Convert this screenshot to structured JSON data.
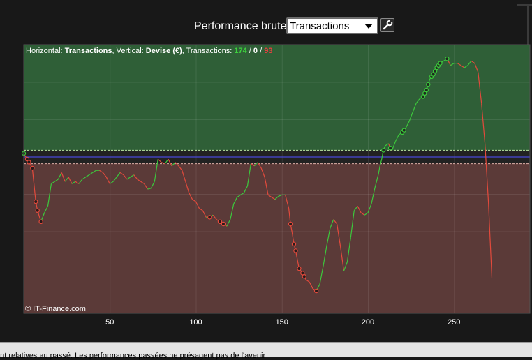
{
  "header": {
    "title": "Performance brute",
    "view_selected": "Transactions",
    "tool_icon": "wrench-icon"
  },
  "info": {
    "h_prefix": "Horizontal: ",
    "h_value": "Transactions",
    "v_prefix": ", Vertical: ",
    "v_value": "Devise (€)",
    "t_prefix": ", Transactions: ",
    "t_win": "174",
    "sep1": " / ",
    "t_flat": "0",
    "sep2": " / ",
    "t_loss": "93"
  },
  "watermark": "© IT-Finance.com",
  "footer": {
    "disclaimer": "ont relatives au passé. Les performances passées ne présagent pas de l'avenir"
  },
  "colors": {
    "profit_zone": "#2f5f37",
    "loss_zone": "#5b3a38",
    "gain_line": "#3cc83c",
    "loss_line": "#e24a3c",
    "baseline": "#4a4ad8",
    "win_count": "#3ed23e",
    "loss_count": "#e84040"
  },
  "chart_data": {
    "type": "line",
    "xlabel": "",
    "ylabel": "",
    "x_ticks": [
      50,
      100,
      150,
      200,
      250
    ],
    "xlim": [
      0,
      293
    ],
    "grid": true,
    "baseline": 0,
    "upper_band": 0.15,
    "lower_band": -0.15,
    "y_unit_note": "no y tick labels shown",
    "series": [
      {
        "points": [
          [
            0,
            0.08
          ],
          [
            2,
            -0.05
          ],
          [
            4,
            -0.18
          ],
          [
            5,
            -0.25
          ],
          [
            7,
            -1.0
          ],
          [
            8,
            -1.2
          ],
          [
            10,
            -1.45
          ],
          [
            12,
            -1.25
          ],
          [
            14,
            -1.1
          ],
          [
            16,
            -0.6
          ],
          [
            18,
            -0.55
          ],
          [
            20,
            -0.5
          ],
          [
            22,
            -0.35
          ],
          [
            24,
            -0.55
          ],
          [
            26,
            -0.45
          ],
          [
            28,
            -0.6
          ],
          [
            30,
            -0.55
          ],
          [
            32,
            -0.6
          ],
          [
            34,
            -0.5
          ],
          [
            36,
            -0.45
          ],
          [
            38,
            -0.4
          ],
          [
            40,
            -0.35
          ],
          [
            42,
            -0.3
          ],
          [
            44,
            -0.3
          ],
          [
            46,
            -0.35
          ],
          [
            48,
            -0.45
          ],
          [
            50,
            -0.6
          ],
          [
            52,
            -0.55
          ],
          [
            54,
            -0.45
          ],
          [
            56,
            -0.35
          ],
          [
            58,
            -0.4
          ],
          [
            60,
            -0.5
          ],
          [
            62,
            -0.45
          ],
          [
            64,
            -0.4
          ],
          [
            66,
            -0.5
          ],
          [
            68,
            -0.55
          ],
          [
            70,
            -0.6
          ],
          [
            72,
            -0.72
          ],
          [
            74,
            -0.7
          ],
          [
            76,
            -0.55
          ],
          [
            78,
            -0.05
          ],
          [
            80,
            -0.12
          ],
          [
            82,
            -0.15
          ],
          [
            84,
            -0.05
          ],
          [
            86,
            -0.2
          ],
          [
            88,
            -0.12
          ],
          [
            90,
            -0.2
          ],
          [
            92,
            -0.3
          ],
          [
            94,
            -0.55
          ],
          [
            96,
            -0.8
          ],
          [
            98,
            -0.95
          ],
          [
            100,
            -1.0
          ],
          [
            102,
            -1.15
          ],
          [
            104,
            -1.2
          ],
          [
            106,
            -1.35
          ],
          [
            108,
            -1.35
          ],
          [
            110,
            -1.3
          ],
          [
            112,
            -1.4
          ],
          [
            114,
            -1.45
          ],
          [
            116,
            -1.5
          ],
          [
            118,
            -1.55
          ],
          [
            120,
            -1.4
          ],
          [
            122,
            -1.05
          ],
          [
            124,
            -0.9
          ],
          [
            126,
            -0.85
          ],
          [
            128,
            -0.8
          ],
          [
            130,
            -0.65
          ],
          [
            132,
            -0.15
          ],
          [
            134,
            -0.2
          ],
          [
            136,
            -0.12
          ],
          [
            138,
            -0.25
          ],
          [
            140,
            -0.45
          ],
          [
            142,
            -0.85
          ],
          [
            144,
            -0.9
          ],
          [
            146,
            -0.95
          ],
          [
            148,
            -0.88
          ],
          [
            150,
            -0.85
          ],
          [
            152,
            -0.85
          ],
          [
            154,
            -1.15
          ],
          [
            155,
            -1.5
          ],
          [
            156,
            -1.7
          ],
          [
            157,
            -1.95
          ],
          [
            158,
            -2.1
          ],
          [
            160,
            -2.5
          ],
          [
            162,
            -2.6
          ],
          [
            164,
            -2.75
          ],
          [
            166,
            -2.8
          ],
          [
            168,
            -2.95
          ],
          [
            170,
            -3.0
          ],
          [
            172,
            -2.85
          ],
          [
            174,
            -2.45
          ],
          [
            176,
            -2.0
          ],
          [
            178,
            -1.6
          ],
          [
            180,
            -1.4
          ],
          [
            182,
            -1.5
          ],
          [
            184,
            -2.0
          ],
          [
            186,
            -2.55
          ],
          [
            188,
            -2.35
          ],
          [
            190,
            -1.8
          ],
          [
            192,
            -1.2
          ],
          [
            194,
            -1.1
          ],
          [
            196,
            -1.25
          ],
          [
            198,
            -1.3
          ],
          [
            200,
            -1.25
          ],
          [
            202,
            -1.05
          ],
          [
            204,
            -0.7
          ],
          [
            206,
            -0.4
          ],
          [
            207,
            -0.2
          ],
          [
            208,
            -0.05
          ],
          [
            209,
            0.15
          ],
          [
            210,
            0.25
          ],
          [
            212,
            0.3
          ],
          [
            213,
            0.2
          ],
          [
            214,
            0.15
          ],
          [
            216,
            0.35
          ],
          [
            218,
            0.5
          ],
          [
            220,
            0.55
          ],
          [
            222,
            0.65
          ],
          [
            224,
            0.8
          ],
          [
            226,
            1.0
          ],
          [
            228,
            1.2
          ],
          [
            230,
            1.3
          ],
          [
            232,
            1.35
          ],
          [
            234,
            1.5
          ],
          [
            236,
            1.75
          ],
          [
            238,
            1.85
          ],
          [
            240,
            2.0
          ],
          [
            242,
            2.1
          ],
          [
            244,
            2.15
          ],
          [
            246,
            2.2
          ],
          [
            248,
            2.05
          ],
          [
            250,
            2.1
          ],
          [
            252,
            2.1
          ],
          [
            254,
            2.05
          ],
          [
            256,
            2.0
          ],
          [
            258,
            2.05
          ],
          [
            260,
            2.15
          ],
          [
            262,
            2.1
          ],
          [
            264,
            1.9
          ],
          [
            266,
            1.2
          ],
          [
            268,
            0.3
          ],
          [
            270,
            -1.0
          ],
          [
            272,
            -2.7
          ]
        ]
      }
    ],
    "markers_gain_x": [
      0,
      209,
      213,
      220,
      221,
      232,
      233,
      234,
      235,
      237,
      238,
      239,
      240,
      241,
      242,
      246
    ],
    "markers_loss_x": [
      2,
      3,
      5,
      7,
      8,
      10,
      108,
      114,
      116,
      155,
      157,
      158,
      160,
      162,
      163,
      170
    ]
  }
}
